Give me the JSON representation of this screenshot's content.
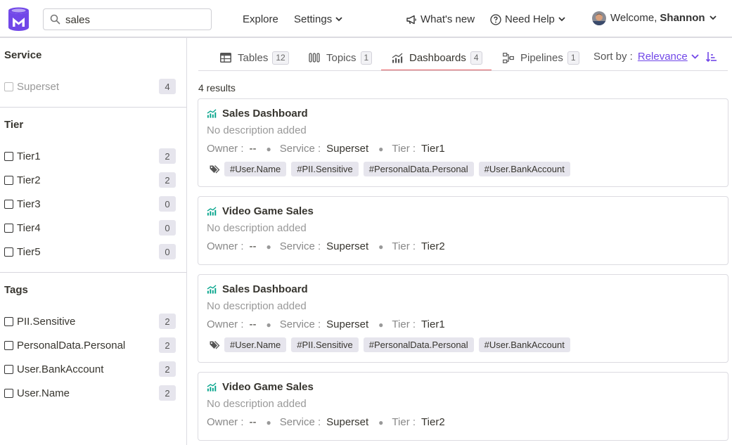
{
  "header": {
    "search": {
      "value": "sales"
    },
    "nav": {
      "explore": "Explore",
      "settings": "Settings",
      "whats_new": "What's new",
      "need_help": "Need Help"
    },
    "user": {
      "welcome": "Welcome,",
      "name": "Shannon"
    }
  },
  "sidebar": {
    "service": {
      "title": "Service",
      "items": [
        {
          "label": "Superset",
          "count": "4"
        }
      ]
    },
    "tier": {
      "title": "Tier",
      "items": [
        {
          "label": "Tier1",
          "count": "2"
        },
        {
          "label": "Tier2",
          "count": "2"
        },
        {
          "label": "Tier3",
          "count": "0"
        },
        {
          "label": "Tier4",
          "count": "0"
        },
        {
          "label": "Tier5",
          "count": "0"
        }
      ]
    },
    "tags": {
      "title": "Tags",
      "items": [
        {
          "label": "PII.Sensitive",
          "count": "2"
        },
        {
          "label": "PersonalData.Personal",
          "count": "2"
        },
        {
          "label": "User.BankAccount",
          "count": "2"
        },
        {
          "label": "User.Name",
          "count": "2"
        }
      ]
    }
  },
  "tabs": [
    {
      "label": "Tables",
      "count": "12"
    },
    {
      "label": "Topics",
      "count": "1"
    },
    {
      "label": "Dashboards",
      "count": "4"
    },
    {
      "label": "Pipelines",
      "count": "1"
    }
  ],
  "sort": {
    "label": "Sort by :",
    "value": "Relevance"
  },
  "results_count": "4 results",
  "meta_labels": {
    "owner": "Owner :",
    "service": "Service :",
    "tier": "Tier :"
  },
  "cards": [
    {
      "title": "Sales Dashboard",
      "description": "No description added",
      "owner": "--",
      "service": "Superset",
      "tier": "Tier1",
      "tags": [
        "#User.Name",
        "#PII.Sensitive",
        "#PersonalData.Personal",
        "#User.BankAccount"
      ]
    },
    {
      "title": "Video Game Sales",
      "description": "No description added",
      "owner": "--",
      "service": "Superset",
      "tier": "Tier2",
      "tags": []
    },
    {
      "title": "Sales Dashboard",
      "description": "No description added",
      "owner": "--",
      "service": "Superset",
      "tier": "Tier1",
      "tags": [
        "#User.Name",
        "#PII.Sensitive",
        "#PersonalData.Personal",
        "#User.BankAccount"
      ]
    },
    {
      "title": "Video Game Sales",
      "description": "No description added",
      "owner": "--",
      "service": "Superset",
      "tier": "Tier2",
      "tags": []
    }
  ],
  "colors": {
    "brand": "#7147e8",
    "active_tab": "#e6595e",
    "chart_icon": "#00a38a"
  }
}
